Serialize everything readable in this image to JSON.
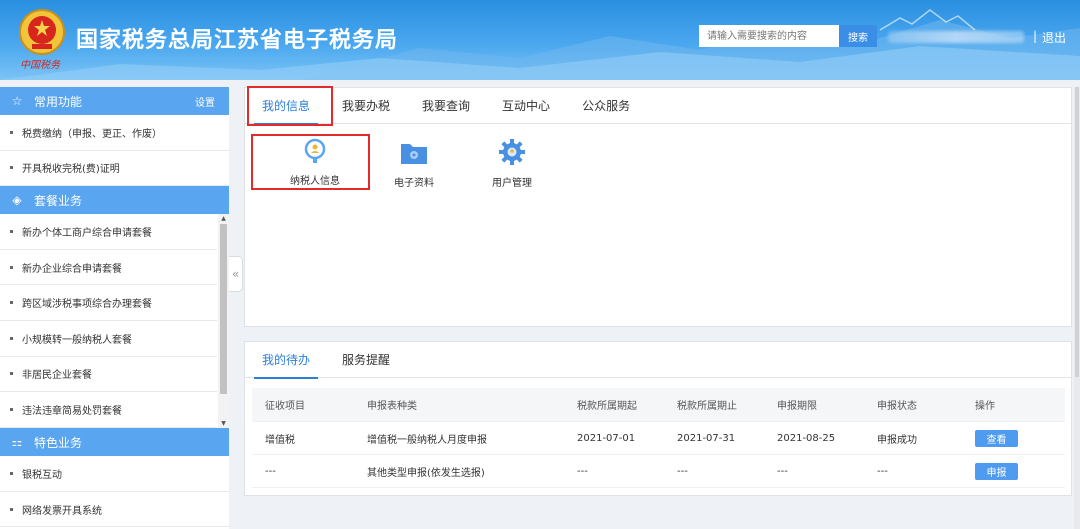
{
  "header": {
    "site_title": "国家税务总局江苏省电子税务局",
    "emblem_sub": "中国税务",
    "search_placeholder": "请输入需要搜索的内容",
    "search_button": "搜索",
    "separator": "|",
    "logout": "退出"
  },
  "sidebar": {
    "common": {
      "title": "常用功能",
      "settings": "设置",
      "items": [
        "税费缴纳（申报、更正、作废）",
        "开具税收完税(费)证明"
      ]
    },
    "packages": {
      "title": "套餐业务",
      "items": [
        "新办个体工商户综合申请套餐",
        "新办企业综合申请套餐",
        "跨区域涉税事项综合办理套餐",
        "小规模转一般纳税人套餐",
        "非居民企业套餐",
        "违法违章简易处罚套餐"
      ]
    },
    "special": {
      "title": "特色业务",
      "items": [
        "银税互动",
        "网络发票开具系统"
      ]
    }
  },
  "top_panel": {
    "tabs": [
      "我的信息",
      "我要办税",
      "我要查询",
      "互动中心",
      "公众服务"
    ],
    "active_tab": 0,
    "icons": [
      {
        "label": "纳税人信息",
        "icon": "taxpayer-info-icon"
      },
      {
        "label": "电子资料",
        "icon": "folder-icon"
      },
      {
        "label": "用户管理",
        "icon": "gear-icon"
      }
    ]
  },
  "bottom_panel": {
    "tabs": [
      "我的待办",
      "服务提醒"
    ],
    "active_tab": 0,
    "columns": [
      "征收项目",
      "申报表种类",
      "税款所属期起",
      "税款所属期止",
      "申报期限",
      "申报状态",
      "操作"
    ],
    "rows": [
      {
        "item": "增值税",
        "type": "增值税一般纳税人月度申报",
        "start": "2021-07-01",
        "end": "2021-07-31",
        "deadline": "2021-08-25",
        "status": "申报成功",
        "action": "查看"
      },
      {
        "item": "---",
        "type": "其他类型申报(依发生选报)",
        "start": "---",
        "end": "---",
        "deadline": "---",
        "status": "---",
        "action": "申报"
      }
    ]
  },
  "colors": {
    "accent": "#2b7fd9",
    "sidebar_header": "#5aa5ef",
    "highlight": "#e32b2b",
    "button": "#4f9bf0"
  }
}
